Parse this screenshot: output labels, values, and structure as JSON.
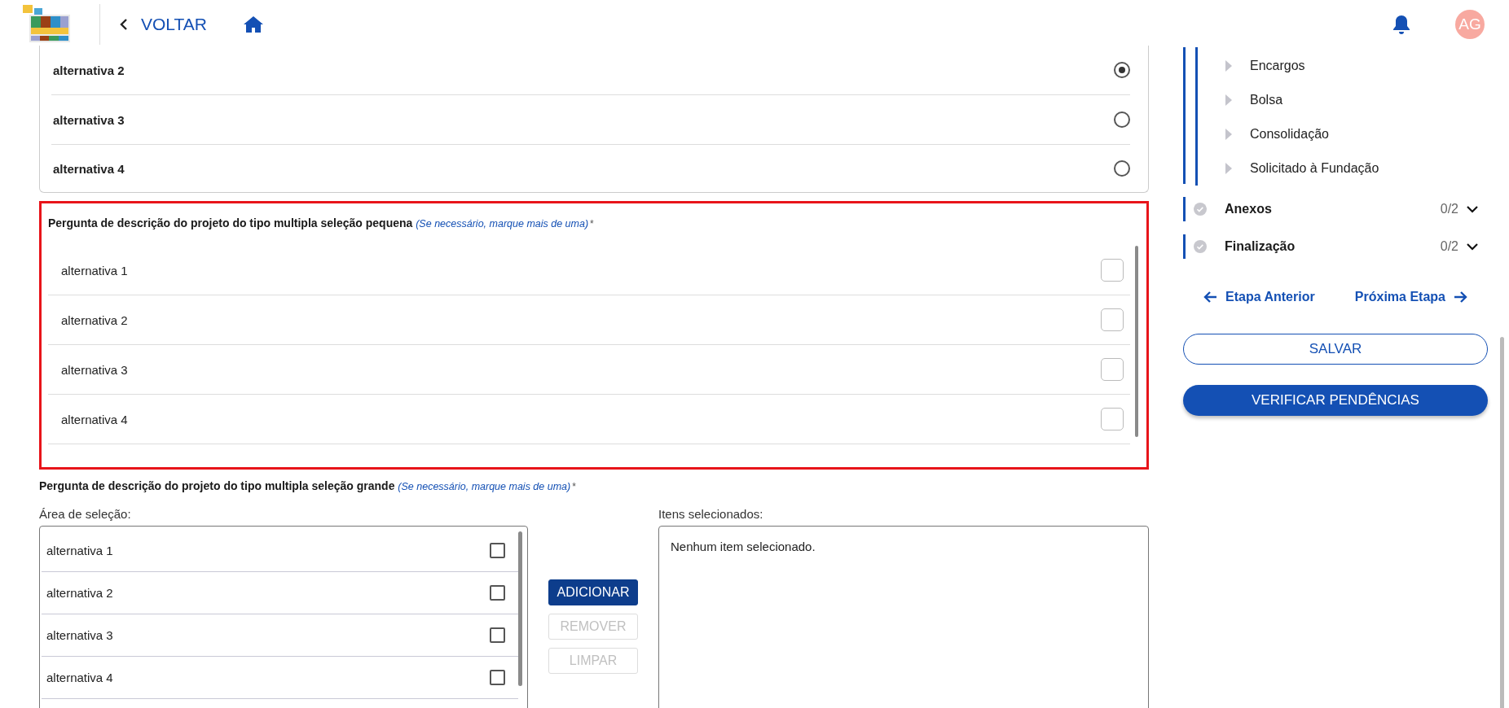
{
  "header": {
    "back_label": "VOLTAR",
    "avatar_initials": "AG"
  },
  "radio_question": {
    "options": [
      {
        "label": "alternativa 2",
        "selected": true
      },
      {
        "label": "alternativa 3",
        "selected": false
      },
      {
        "label": "alternativa 4",
        "selected": false
      }
    ]
  },
  "small_question": {
    "title": "Pergunta de descrição do projeto do tipo multipla seleção pequena",
    "hint": "(Se necessário, marque mais de uma)",
    "required_mark": "*",
    "options": [
      {
        "label": "alternativa 1",
        "checked": false
      },
      {
        "label": "alternativa 2",
        "checked": false
      },
      {
        "label": "alternativa 3",
        "checked": false
      },
      {
        "label": "alternativa 4",
        "checked": false
      }
    ]
  },
  "large_question": {
    "title": "Pergunta de descrição do projeto do tipo multipla seleção grande",
    "hint": "(Se necessário, marque mais de uma)",
    "required_mark": "*",
    "selection_area_label": "Área de seleção:",
    "selected_items_label": "Itens selecionados:",
    "empty_message": "Nenhum item selecionado.",
    "options": [
      {
        "label": "alternativa 1",
        "checked": false
      },
      {
        "label": "alternativa 2",
        "checked": false
      },
      {
        "label": "alternativa 3",
        "checked": false
      },
      {
        "label": "alternativa 4",
        "checked": false
      }
    ],
    "buttons": [
      {
        "label": "ADICIONAR",
        "disabled": false
      },
      {
        "label": "REMOVER",
        "disabled": true
      },
      {
        "label": "LIMPAR",
        "disabled": true
      }
    ]
  },
  "sidebar": {
    "sub_items": [
      "Encargos",
      "Bolsa",
      "Consolidação",
      "Solicitado à Fundação"
    ],
    "sections": [
      {
        "title": "Anexos",
        "progress": "0/2",
        "completed": false
      },
      {
        "title": "Finalização",
        "progress": "0/2",
        "completed": false
      }
    ],
    "prev_label": "Etapa Anterior",
    "next_label": "Próxima Etapa",
    "save_label": "SALVAR",
    "verify_label": "VERIFICAR PENDÊNCIAS"
  }
}
